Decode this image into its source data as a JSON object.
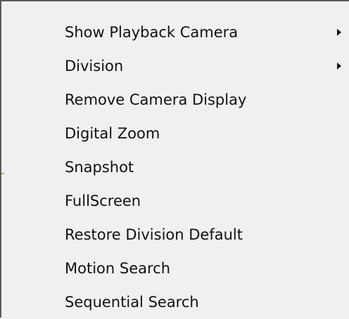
{
  "menu": {
    "items": [
      {
        "label": "Show Playback Camera",
        "has_submenu": true
      },
      {
        "label": "Division",
        "has_submenu": true
      },
      {
        "label": "Remove Camera Display",
        "has_submenu": false
      },
      {
        "label": "Digital Zoom",
        "has_submenu": false
      },
      {
        "label": "Snapshot",
        "has_submenu": false
      },
      {
        "label": "FullScreen",
        "has_submenu": false
      },
      {
        "label": "Restore Division Default",
        "has_submenu": false
      },
      {
        "label": "Motion Search",
        "has_submenu": false
      },
      {
        "label": "Sequential Search",
        "has_submenu": false
      }
    ],
    "submenu_arrow_icon": "chevron-right-icon"
  },
  "colors": {
    "background": "#f0f0f0",
    "text": "#111111",
    "border": "#5a5a5a"
  }
}
